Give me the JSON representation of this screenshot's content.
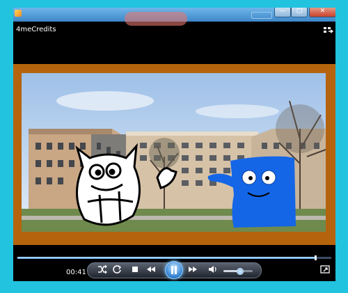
{
  "player": {
    "now_playing": "4meCredits",
    "elapsed": "00:41",
    "seek_progress": 0.95,
    "volume_level": 0.55
  },
  "icons": {
    "app": "media-player-app-icon",
    "minimize": "minimize-icon",
    "maximize": "maximize-icon",
    "close": "close-icon",
    "switch_to_library": "switch-to-library-icon",
    "shuffle": "shuffle-icon",
    "repeat": "repeat-icon",
    "stop": "stop-icon",
    "previous": "previous-icon",
    "play_pause": "pause-icon",
    "next": "next-icon",
    "mute": "speaker-icon",
    "fullscreen": "fullscreen-icon"
  },
  "colors": {
    "desktop": "#21c3df",
    "video_border": "#b5640d",
    "accent": "#2e7fd0"
  }
}
